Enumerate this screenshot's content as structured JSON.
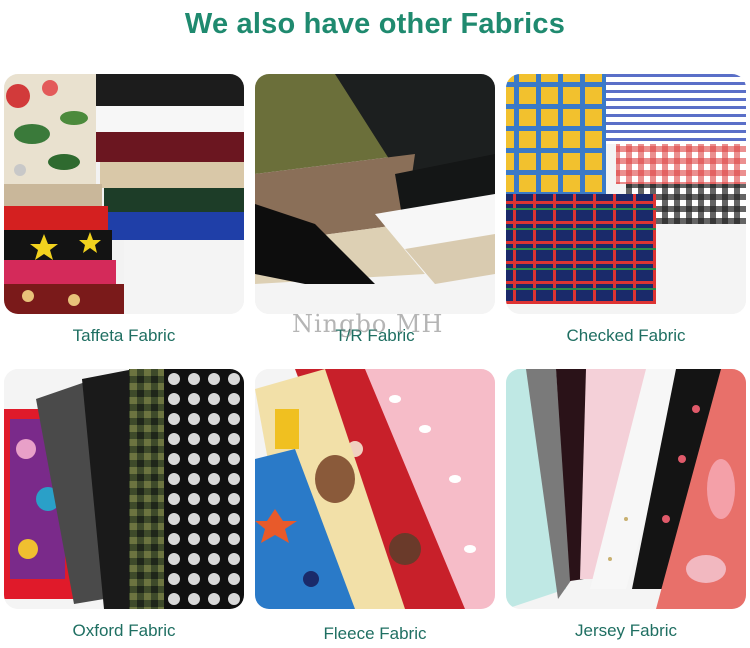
{
  "page": {
    "title": "We also have other Fabrics",
    "title_color": "#1f8a6f",
    "label_color": "#1f6f62"
  },
  "watermark": "Ningbo MH",
  "fabrics": [
    {
      "name": "Taffeta Fabric"
    },
    {
      "name": "T/R Fabric"
    },
    {
      "name": "Checked Fabric"
    },
    {
      "name": "Oxford Fabric"
    },
    {
      "name": "Fleece Fabric"
    },
    {
      "name": "Jersey Fabric"
    }
  ]
}
